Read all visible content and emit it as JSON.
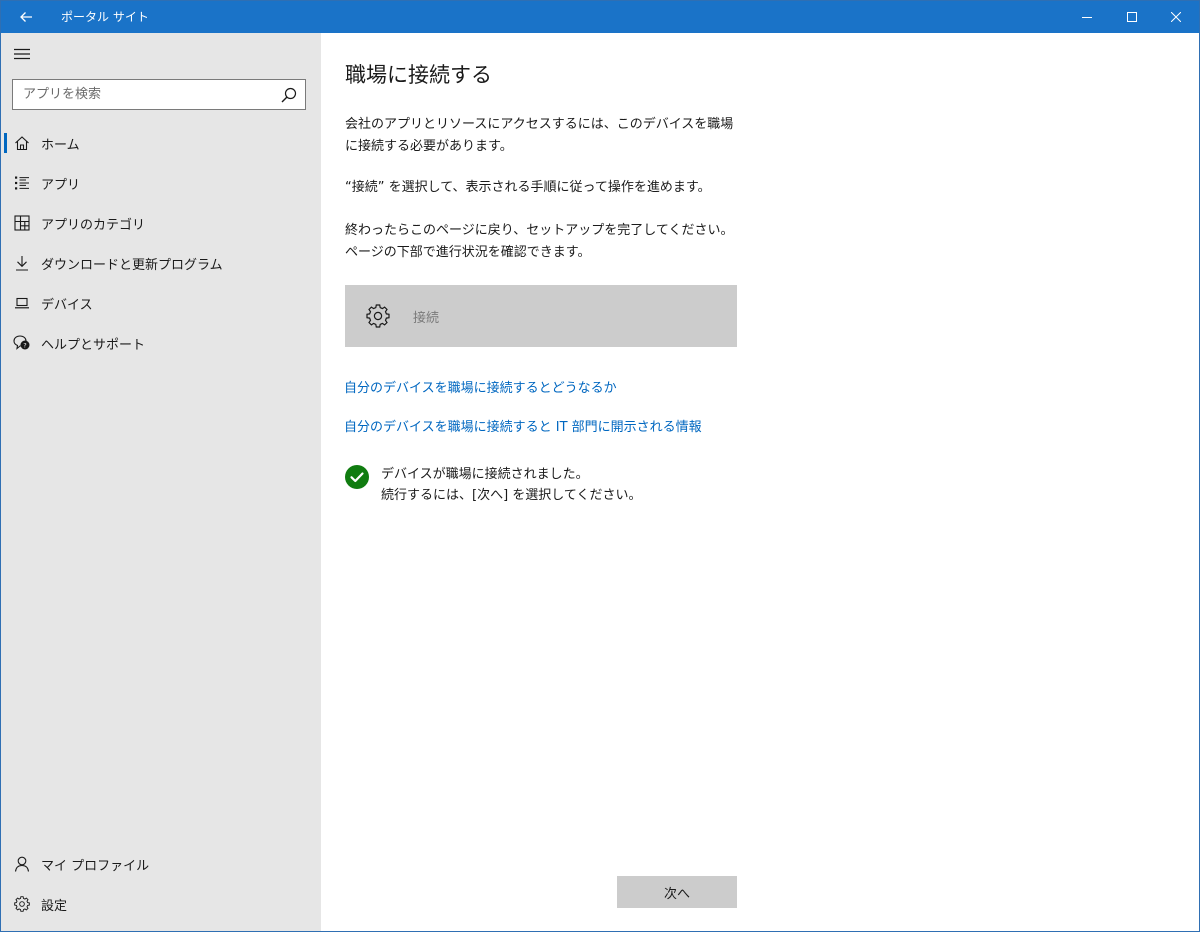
{
  "window": {
    "title": "ポータル サイト"
  },
  "sidebar": {
    "search_placeholder": "アプリを検索",
    "items": [
      {
        "label": "ホーム",
        "icon": "home-icon"
      },
      {
        "label": "アプリ",
        "icon": "apps-list-icon"
      },
      {
        "label": "アプリのカテゴリ",
        "icon": "categories-icon"
      },
      {
        "label": "ダウンロードと更新プログラム",
        "icon": "download-icon"
      },
      {
        "label": "デバイス",
        "icon": "laptop-icon"
      },
      {
        "label": "ヘルプとサポート",
        "icon": "help-chat-icon"
      }
    ],
    "bottom_items": [
      {
        "label": "マイ プロファイル",
        "icon": "person-icon"
      },
      {
        "label": "設定",
        "icon": "gear-icon"
      }
    ]
  },
  "main": {
    "title": "職場に接続する",
    "paragraphs": [
      "会社のアプリとリソースにアクセスするには、このデバイスを職場に接続する必要があります。",
      "“接続” を選択して、表示される手順に従って操作を進めます。",
      "終わったらこのページに戻り、セットアップを完了してください。ページの下部で進行状況を確認できます。"
    ],
    "connect_label": "接続",
    "links": [
      "自分のデバイスを職場に接続するとどうなるか",
      "自分のデバイスを職場に接続すると IT 部門に開示される情報"
    ],
    "status": {
      "line1": "デバイスが職場に接続されました。",
      "line2": "続行するには、[次へ] を選択してください。"
    },
    "next_label": "次へ"
  },
  "colors": {
    "titlebar": "#1a73c8",
    "sidebar_bg": "#e6e6e6",
    "link": "#0067c0",
    "success": "#107c10",
    "button_disabled": "#cccccc"
  }
}
